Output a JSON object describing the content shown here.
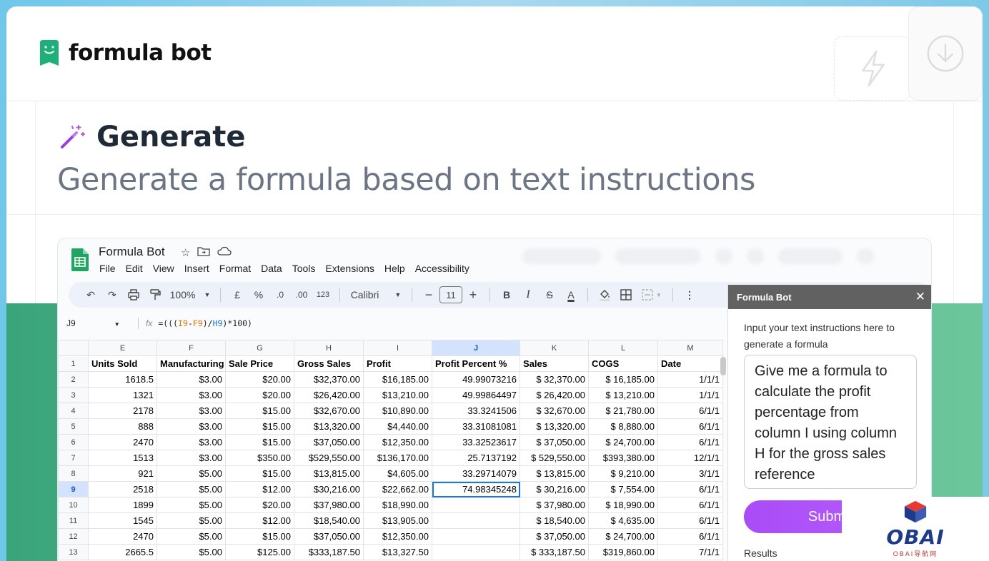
{
  "brand": {
    "name": "formula bot"
  },
  "section": {
    "title": "Generate",
    "subtitle": "Generate a formula based on text instructions"
  },
  "sheet": {
    "doc_title": "Formula Bot",
    "menu": [
      "File",
      "Edit",
      "View",
      "Insert",
      "Format",
      "Data",
      "Tools",
      "Extensions",
      "Help",
      "Accessibility"
    ],
    "toolbar": {
      "zoom": "100%",
      "currency": "£",
      "percent": "%",
      "dec_less": ".0",
      "dec_more": ".00",
      "number_format": "123",
      "font": "Calibri",
      "font_size": "11",
      "minus": "−",
      "plus": "+",
      "bold": "B",
      "italic": "I",
      "strike": "S",
      "text_color": "A"
    },
    "cell_ref": "J9",
    "formula_parts": [
      "=(((",
      "I9",
      "-",
      "F9",
      ")/",
      "H9",
      ")*100)"
    ],
    "columns": [
      "E",
      "F",
      "G",
      "H",
      "I",
      "J",
      "K",
      "L",
      "M"
    ],
    "selected_column": "J",
    "selected_row": "9",
    "rows": [
      [
        "1",
        "Units Sold",
        "Manufacturing",
        "Sale Price",
        "Gross Sales",
        "Profit",
        "Profit Percent %",
        "Sales",
        "COGS",
        "Date"
      ],
      [
        "2",
        "1618.5",
        "$3.00",
        "$20.00",
        "$32,370.00",
        "$16,185.00",
        "49.99073216",
        "$ 32,370.00",
        "$ 16,185.00",
        "1/1/1"
      ],
      [
        "3",
        "1321",
        "$3.00",
        "$20.00",
        "$26,420.00",
        "$13,210.00",
        "49.99864497",
        "$ 26,420.00",
        "$ 13,210.00",
        "1/1/1"
      ],
      [
        "4",
        "2178",
        "$3.00",
        "$15.00",
        "$32,670.00",
        "$10,890.00",
        "33.3241506",
        "$ 32,670.00",
        "$ 21,780.00",
        "6/1/1"
      ],
      [
        "5",
        "888",
        "$3.00",
        "$15.00",
        "$13,320.00",
        "$4,440.00",
        "33.31081081",
        "$ 13,320.00",
        "$ 8,880.00",
        "6/1/1"
      ],
      [
        "6",
        "2470",
        "$3.00",
        "$15.00",
        "$37,050.00",
        "$12,350.00",
        "33.32523617",
        "$ 37,050.00",
        "$ 24,700.00",
        "6/1/1"
      ],
      [
        "7",
        "1513",
        "$3.00",
        "$350.00",
        "$529,550.00",
        "$136,170.00",
        "25.7137192",
        "$ 529,550.00",
        "$393,380.00",
        "12/1/1"
      ],
      [
        "8",
        "921",
        "$5.00",
        "$15.00",
        "$13,815.00",
        "$4,605.00",
        "33.29714079",
        "$ 13,815.00",
        "$ 9,210.00",
        "3/1/1"
      ],
      [
        "9",
        "2518",
        "$5.00",
        "$12.00",
        "$30,216.00",
        "$22,662.00",
        "74.98345248",
        "$ 30,216.00",
        "$ 7,554.00",
        "6/1/1"
      ],
      [
        "10",
        "1899",
        "$5.00",
        "$20.00",
        "$37,980.00",
        "$18,990.00",
        "",
        "$ 37,980.00",
        "$ 18,990.00",
        "6/1/1"
      ],
      [
        "11",
        "1545",
        "$5.00",
        "$12.00",
        "$18,540.00",
        "$13,905.00",
        "",
        "$ 18,540.00",
        "$ 4,635.00",
        "6/1/1"
      ],
      [
        "12",
        "2470",
        "$5.00",
        "$15.00",
        "$37,050.00",
        "$12,350.00",
        "",
        "$ 37,050.00",
        "$ 24,700.00",
        "6/1/1"
      ],
      [
        "13",
        "2665.5",
        "$5.00",
        "$125.00",
        "$333,187.50",
        "$13,327.50",
        "",
        "$ 333,187.50",
        "$319,860.00",
        "7/1/1"
      ]
    ]
  },
  "panel": {
    "title": "Formula Bot",
    "instructions": "Input your text instructions here to generate a formula",
    "textarea_value": "Give me a formula to calculate the profit percentage from column I using column H for the gross sales reference",
    "submit_label": "Submit",
    "results_label": "Results"
  },
  "watermark": {
    "text": "OBAI",
    "sub": "OBAI导航网"
  },
  "colors": {
    "brand_green": "#21b07a",
    "accent_purple": "#b05cff",
    "band_green": "#4fb487"
  }
}
